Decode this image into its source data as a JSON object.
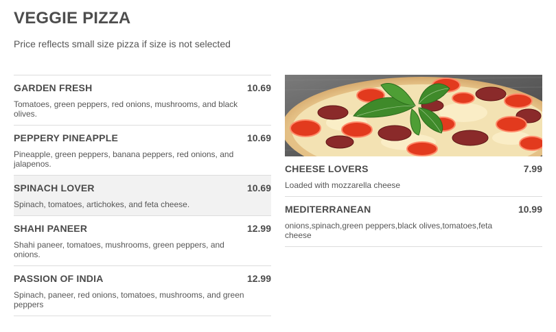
{
  "header": {
    "title": "VEGGIE PIZZA",
    "subtitle": "Price reflects small size pizza if size is not selected"
  },
  "menu_left": [
    {
      "name": "GARDEN FRESH",
      "price": "10.69",
      "desc": "Tomatoes, green peppers, red onions, mushrooms, and black olives."
    },
    {
      "name": "PEPPERY PINEAPPLE",
      "price": "10.69",
      "desc": "Pineapple, green peppers, banana peppers, red onions, and jalapenos."
    },
    {
      "name": "SPINACH LOVER",
      "price": "10.69",
      "desc": "Spinach, tomatoes, artichokes, and feta cheese."
    },
    {
      "name": "SHAHI PANEER",
      "price": "12.99",
      "desc": "Shahi paneer, tomatoes, mushrooms, green peppers, and onions."
    },
    {
      "name": "PASSION OF INDIA",
      "price": "12.99",
      "desc": "Spinach, paneer, red onions, tomatoes, mushrooms, and green peppers"
    }
  ],
  "menu_right": [
    {
      "name": "CHEESE LOVERS",
      "price": "7.99",
      "desc": "Loaded with mozzarella cheese"
    },
    {
      "name": "MEDITERRANEAN",
      "price": "10.99",
      "desc": "onions,spinach,green peppers,black olives,tomatoes,feta cheese"
    }
  ],
  "colors": {
    "hover_row": "#f2f2f2",
    "divider": "#dcdcdc",
    "text": "#4a4a4a"
  }
}
